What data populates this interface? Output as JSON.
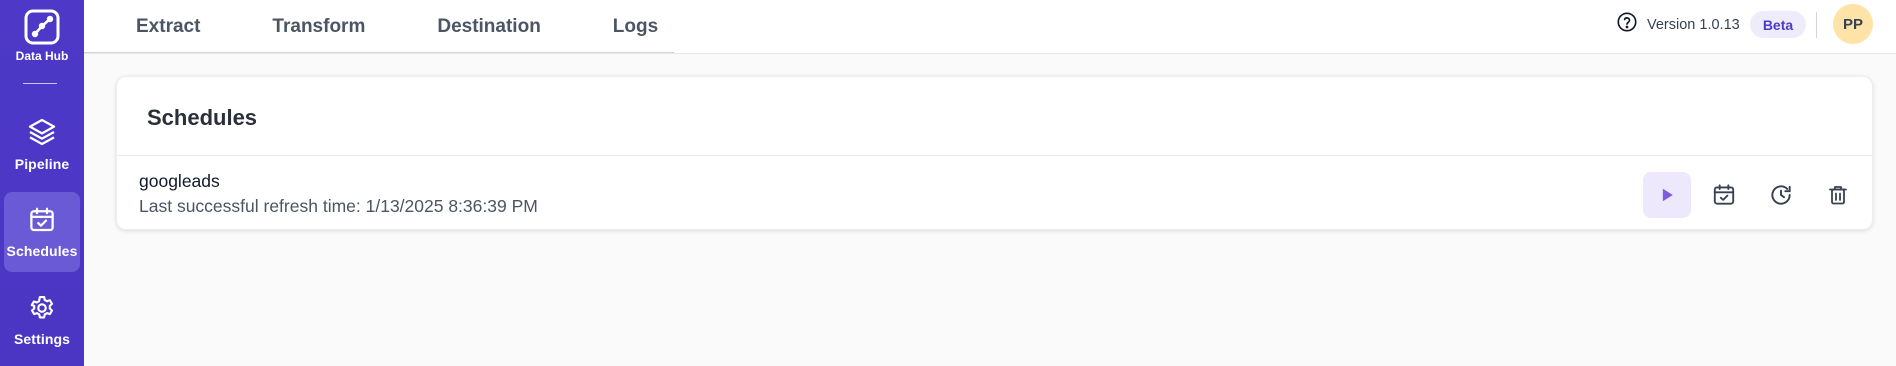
{
  "sidebar": {
    "brand_label": "Data Hub",
    "items": [
      {
        "label": "Pipeline",
        "icon": "layers-icon",
        "active": false
      },
      {
        "label": "Schedules",
        "icon": "calendar-check-icon",
        "active": true
      },
      {
        "label": "Settings",
        "icon": "gear-icon",
        "active": false
      }
    ]
  },
  "tabs": [
    {
      "label": "Extract"
    },
    {
      "label": "Transform"
    },
    {
      "label": "Destination"
    },
    {
      "label": "Logs"
    }
  ],
  "header": {
    "version": "Version 1.0.13",
    "badge": "Beta",
    "avatar_initials": "PP"
  },
  "schedules": {
    "title": "Schedules",
    "rows": [
      {
        "name": "googleads",
        "status": "Last successful refresh time: 1/13/2025 8:36:39 PM",
        "actions": [
          "play-icon",
          "calendar-check-icon",
          "history-icon",
          "trash-icon"
        ]
      }
    ]
  },
  "colors": {
    "sidebar": "#4d38c7",
    "active_nav": "#6b5ad6",
    "accent": "#7c5ce0",
    "badge_bg": "#eeebfb",
    "avatar_bg": "#fde3a7"
  }
}
